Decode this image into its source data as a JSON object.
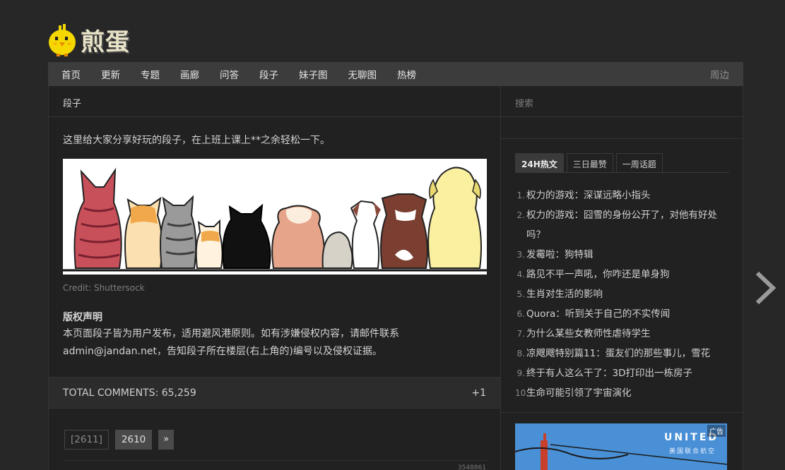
{
  "brand": {
    "logo_text": "煎蛋"
  },
  "nav": {
    "items": [
      "首页",
      "更新",
      "专题",
      "画廊",
      "问答",
      "段子",
      "妹子图",
      "无聊图",
      "热榜"
    ],
    "right_label": "周边"
  },
  "main": {
    "breadcrumb": "段子",
    "intro": "这里给大家分享好玩的段子，在上班上课上**之余轻松一下。",
    "image_credit": "Credit: Shuttersock",
    "copyright_title": "版权声明",
    "copyright_body": "本页面段子皆为用户发布，适用避风港原则。如有涉嫌侵权内容，请邮件联系admin@jandan.net，告知段子所在楼层(右上角的)编号以及侵权证据。",
    "comments_label": "TOTAL COMMENTS: 65,259",
    "comments_plus": "+1",
    "pager": {
      "current": "[2611]",
      "next_page": "2610",
      "next_symbol": "»"
    },
    "post_id": "3548861"
  },
  "sidebar": {
    "search_placeholder": "搜索",
    "tabs": [
      "24H热文",
      "三日最赞",
      "一周话题"
    ],
    "hot_list": [
      "权力的游戏：深谋远略小指头",
      "权力的游戏：囧雪的身份公开了，对他有好处吗？",
      "发霉啦：狗特辑",
      "路见不平一声吼，你咋还是单身狗",
      "生肖对生活的影响",
      "Quora：听到关于自己的不实传闻",
      "为什么某些女教师性虐待学生",
      "凉飕飕特别篇11：蛋友们的那些事儿，雪花",
      "终于有人这么干了：3D打印出一栋房子",
      "生命可能引领了宇宙演化"
    ],
    "ad": {
      "brand": "UNITED",
      "sub": "美国联合航空",
      "tag": "广告"
    }
  },
  "colors": {
    "background": "#272727",
    "nav": "#3c3c3c",
    "panel": "#212121",
    "ad_blue": "#3c7fc4"
  }
}
